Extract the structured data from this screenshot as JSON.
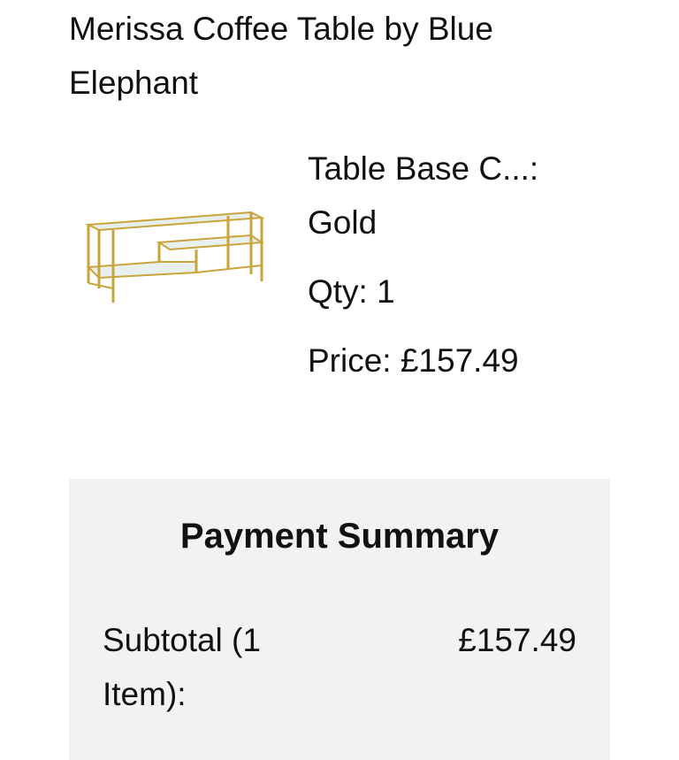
{
  "product": {
    "title": "Merissa Coffee Table by Blue Elephant",
    "option_label": "Table Base C...:",
    "option_value": "Gold",
    "qty_text": "Qty: 1",
    "price_text": "Price: £157.49",
    "image_icon": "glass-gold-coffee-table-image"
  },
  "summary": {
    "title": "Payment Summary",
    "subtotal_label": "Subtotal (1 Item):",
    "subtotal_value": "£157.49"
  },
  "colors": {
    "frame_gold": "#c9a43a",
    "glass": "#e4ecec",
    "panel_background": "#f2f2f2"
  }
}
